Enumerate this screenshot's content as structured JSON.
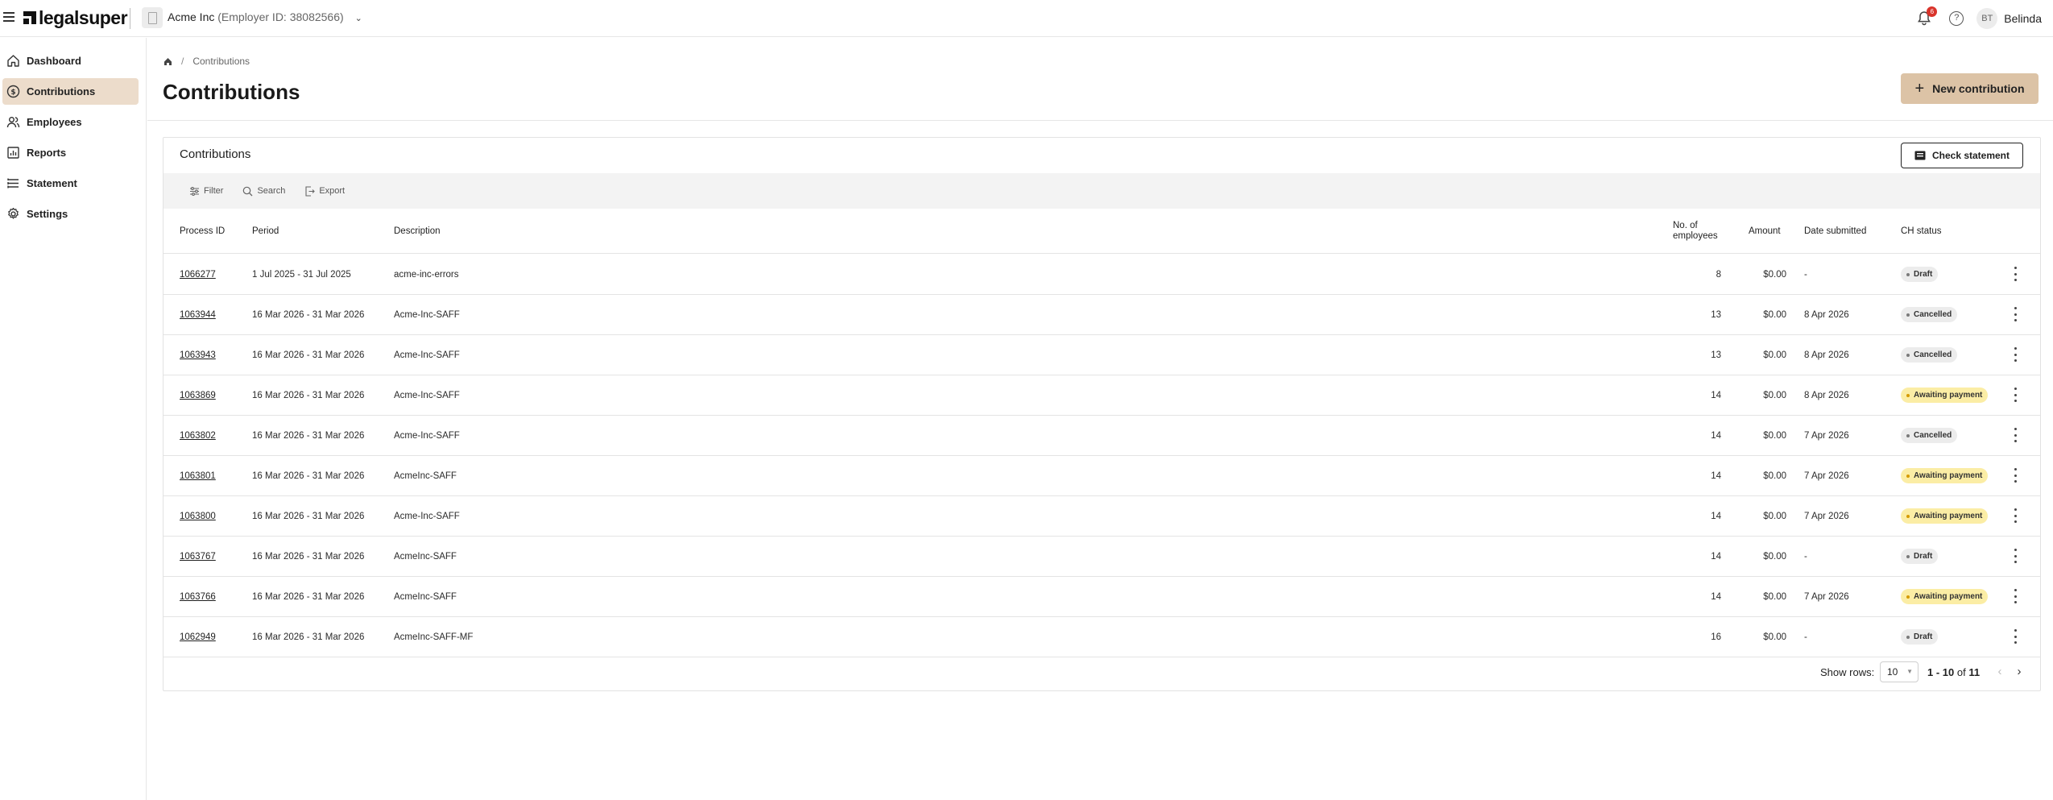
{
  "header": {
    "logo": "legalsuper",
    "employer_name": "Acme Inc",
    "employer_id": "(Employer ID: 38082566)",
    "notification_count": "6",
    "avatar_initials": "BT",
    "user_name": "Belinda"
  },
  "sidebar": {
    "items": [
      {
        "label": "Dashboard",
        "icon": "home-icon",
        "active": false
      },
      {
        "label": "Contributions",
        "icon": "dollar-circle-icon",
        "active": true
      },
      {
        "label": "Employees",
        "icon": "people-icon",
        "active": false
      },
      {
        "label": "Reports",
        "icon": "chart-icon",
        "active": false
      },
      {
        "label": "Statement",
        "icon": "list-icon",
        "active": false
      },
      {
        "label": "Settings",
        "icon": "gear-icon",
        "active": false
      }
    ]
  },
  "breadcrumb": {
    "current": "Contributions"
  },
  "page": {
    "title": "Contributions",
    "new_button": "New contribution"
  },
  "card": {
    "title": "Contributions",
    "check_button": "Check statement",
    "toolbar": {
      "filter": "Filter",
      "search": "Search",
      "export": "Export"
    }
  },
  "table": {
    "columns": {
      "process_id": "Process ID",
      "period": "Period",
      "description": "Description",
      "employees_line1": "No. of",
      "employees_line2": "employees",
      "amount": "Amount",
      "date_submitted": "Date submitted",
      "status": "CH status"
    },
    "rows": [
      {
        "id": "1066277",
        "period": "1 Jul 2025 - 31 Jul 2025",
        "description": "acme-inc-errors",
        "employees": "8",
        "amount": "$0.00",
        "date": "-",
        "status": "Draft"
      },
      {
        "id": "1063944",
        "period": "16 Mar 2026 - 31 Mar 2026",
        "description": "Acme-Inc-SAFF",
        "employees": "13",
        "amount": "$0.00",
        "date": "8 Apr 2026",
        "status": "Cancelled"
      },
      {
        "id": "1063943",
        "period": "16 Mar 2026 - 31 Mar 2026",
        "description": "Acme-Inc-SAFF",
        "employees": "13",
        "amount": "$0.00",
        "date": "8 Apr 2026",
        "status": "Cancelled"
      },
      {
        "id": "1063869",
        "period": "16 Mar 2026 - 31 Mar 2026",
        "description": "Acme-Inc-SAFF",
        "employees": "14",
        "amount": "$0.00",
        "date": "8 Apr 2026",
        "status": "Awaiting payment"
      },
      {
        "id": "1063802",
        "period": "16 Mar 2026 - 31 Mar 2026",
        "description": "Acme-Inc-SAFF",
        "employees": "14",
        "amount": "$0.00",
        "date": "7 Apr 2026",
        "status": "Cancelled"
      },
      {
        "id": "1063801",
        "period": "16 Mar 2026 - 31 Mar 2026",
        "description": "AcmeInc-SAFF",
        "employees": "14",
        "amount": "$0.00",
        "date": "7 Apr 2026",
        "status": "Awaiting payment"
      },
      {
        "id": "1063800",
        "period": "16 Mar 2026 - 31 Mar 2026",
        "description": "Acme-Inc-SAFF",
        "employees": "14",
        "amount": "$0.00",
        "date": "7 Apr 2026",
        "status": "Awaiting payment"
      },
      {
        "id": "1063767",
        "period": "16 Mar 2026 - 31 Mar 2026",
        "description": "AcmeInc-SAFF",
        "employees": "14",
        "amount": "$0.00",
        "date": "-",
        "status": "Draft"
      },
      {
        "id": "1063766",
        "period": "16 Mar 2026 - 31 Mar 2026",
        "description": "AcmeInc-SAFF",
        "employees": "14",
        "amount": "$0.00",
        "date": "7 Apr 2026",
        "status": "Awaiting payment"
      },
      {
        "id": "1062949",
        "period": "16 Mar 2026 - 31 Mar 2026",
        "description": "AcmeInc-SAFF-MF",
        "employees": "16",
        "amount": "$0.00",
        "date": "-",
        "status": "Draft"
      }
    ]
  },
  "pagination": {
    "show_rows_label": "Show rows:",
    "rows_per_page": "10",
    "range": "1 - 10",
    "of": "of",
    "total": "11"
  },
  "colors": {
    "accent": "#dcc3a6",
    "nav_active": "#ecdccb",
    "status_yellow": "#fbeda5",
    "status_grey": "#ececec",
    "notification": "#d9342b"
  }
}
